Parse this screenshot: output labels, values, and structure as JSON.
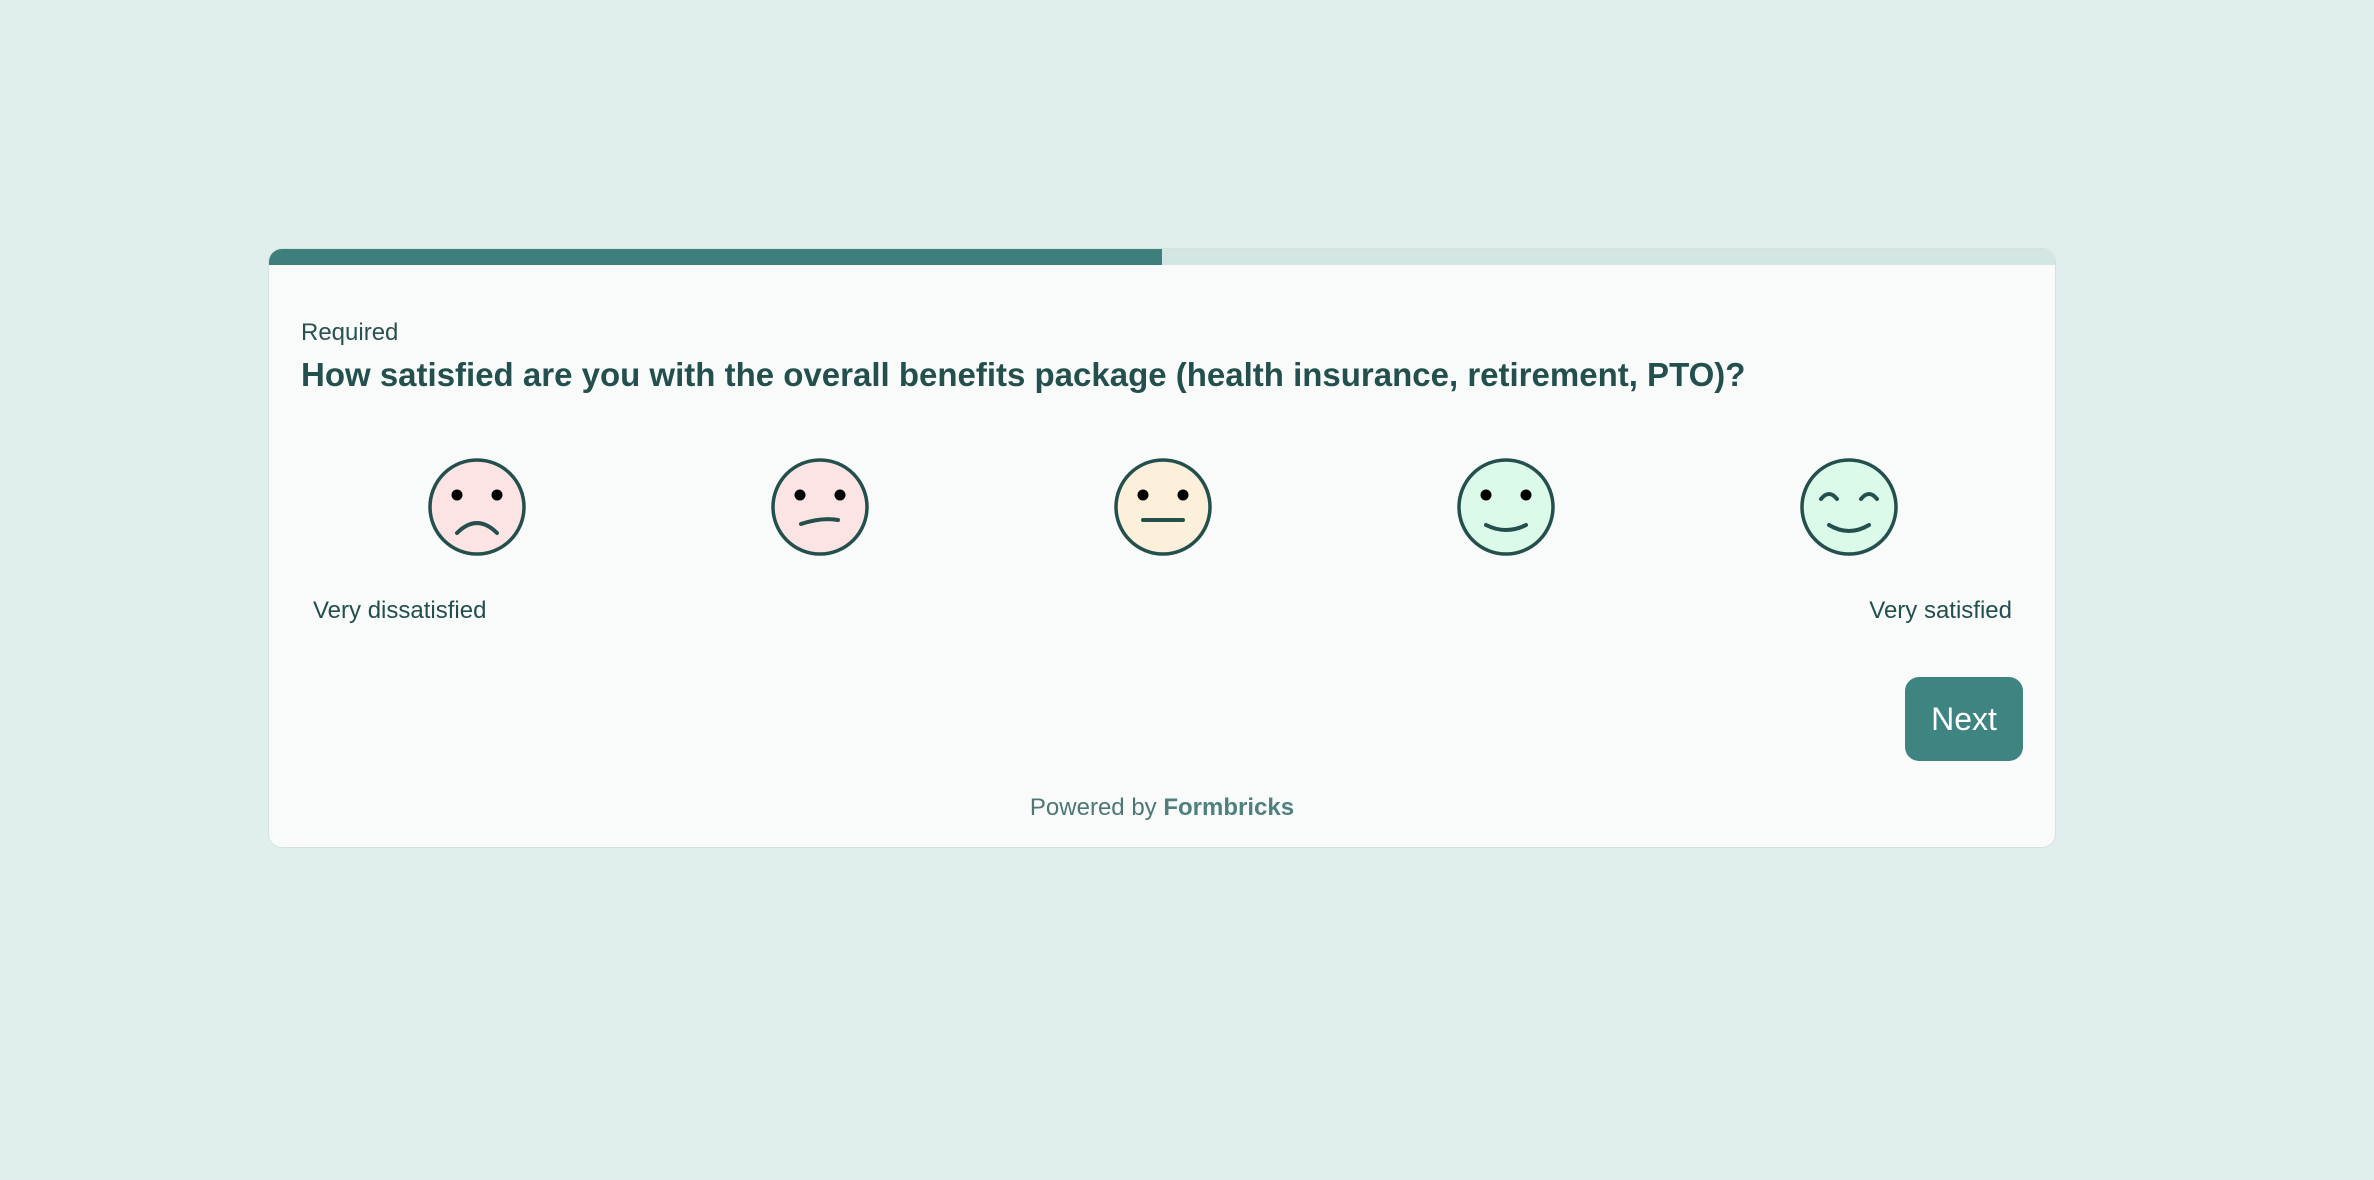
{
  "survey": {
    "progress": 0.5,
    "required_label": "Required",
    "question": "How satisfied are you with the overall benefits package (health insurance, retirement, PTO)?",
    "scale_low_label": "Very dissatisfied",
    "scale_high_label": "Very satisfied",
    "next_label": "Next",
    "options": [
      {
        "value": 1,
        "icon": "frowning-face-icon",
        "fill": "#fce4e4"
      },
      {
        "value": 2,
        "icon": "slightly-frowning-face-icon",
        "fill": "#fce4e4"
      },
      {
        "value": 3,
        "icon": "neutral-face-icon",
        "fill": "#fdf0da"
      },
      {
        "value": 4,
        "icon": "slightly-smiling-face-icon",
        "fill": "#dcfae9"
      },
      {
        "value": 5,
        "icon": "smiling-face-icon",
        "fill": "#dcfae9"
      }
    ]
  },
  "footer": {
    "powered_prefix": "Powered by",
    "brand": "Formbricks"
  },
  "colors": {
    "background": "#e0eeed",
    "accent": "#3e7f7c",
    "text": "#234f4d"
  }
}
